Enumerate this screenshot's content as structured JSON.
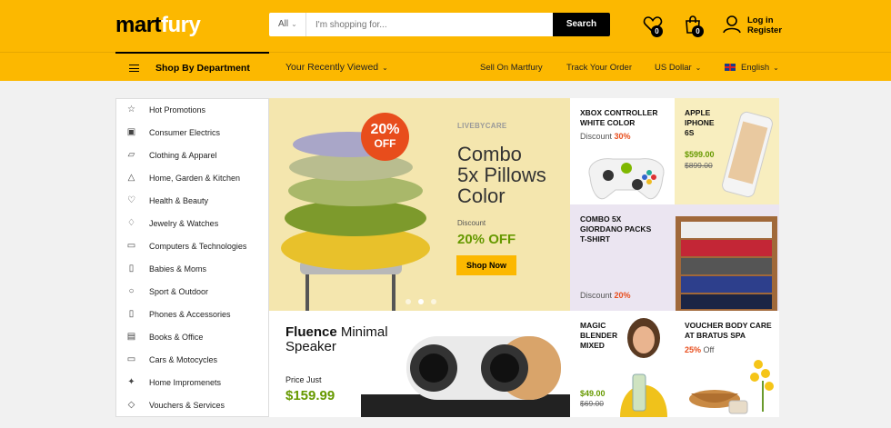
{
  "logo": {
    "part1": "mart",
    "part2": "fury"
  },
  "search": {
    "category": "All",
    "placeholder": "I'm shopping for...",
    "button": "Search"
  },
  "header": {
    "wishlist_count": "0",
    "cart_count": "0",
    "login": "Log in",
    "register": "Register"
  },
  "nav": {
    "shop_by_department": "Shop By Department",
    "recently_viewed": "Your Recently Viewed",
    "sell": "Sell On Martfury",
    "track": "Track Your Order",
    "currency": "US Dollar",
    "language": "English"
  },
  "sidebar": {
    "items": [
      {
        "label": "Hot Promotions",
        "icon": "star-icon"
      },
      {
        "label": "Consumer Electrics",
        "icon": "laundry-icon"
      },
      {
        "label": "Clothing & Apparel",
        "icon": "shirt-icon"
      },
      {
        "label": "Home, Garden & Kitchen",
        "icon": "lamp-icon"
      },
      {
        "label": "Health & Beauty",
        "icon": "heart-pulse-icon"
      },
      {
        "label": "Jewelry & Watches",
        "icon": "diamond-icon"
      },
      {
        "label": "Computers & Technologies",
        "icon": "desktop-icon"
      },
      {
        "label": "Babies & Moms",
        "icon": "baby-bottle-icon"
      },
      {
        "label": "Sport & Outdoor",
        "icon": "ball-icon"
      },
      {
        "label": "Phones & Accessories",
        "icon": "phone-icon"
      },
      {
        "label": "Books & Office",
        "icon": "book-icon"
      },
      {
        "label": "Cars & Motocycles",
        "icon": "car-icon"
      },
      {
        "label": "Home Impromenets",
        "icon": "wrench-icon"
      },
      {
        "label": "Vouchers & Services",
        "icon": "tag-icon"
      }
    ]
  },
  "hero": {
    "brand": "LIVEBYCARE",
    "title_line1": "Combo",
    "title_line2": "5x Pillows",
    "title_line3": "Color",
    "discount_label": "Discount",
    "discount_value": "20% OFF",
    "button": "Shop Now",
    "badge_pct": "20%",
    "badge_off": "OFF"
  },
  "speaker": {
    "title_bold": "Fluence",
    "title_rest": " Minimal",
    "title_line2": "Speaker",
    "price_label": "Price Just",
    "price": "$159.99"
  },
  "tiles": {
    "xbox": {
      "line1": "XBOX CONTROLLER",
      "line2": "WHITE COLOR",
      "discount_label": "Discount",
      "discount": "30%"
    },
    "iphone": {
      "line1": "APPLE",
      "line2": "IPHONE",
      "line3": "6S",
      "price": "$599.00",
      "old_price": "$899.00"
    },
    "tshirt": {
      "line1": "COMBO 5X",
      "line2": "GIORDANO PACKS",
      "line3": "T-SHIRT",
      "discount_label": "Discount",
      "discount": "20%"
    },
    "blender": {
      "line1": "MAGIC",
      "line2": "BLENDER",
      "line3": "MIXED",
      "price": "$49.00",
      "old_price": "$69.00"
    },
    "voucher": {
      "line1": "VOUCHER BODY CARE",
      "line2": "AT BRATUS SPA",
      "pct": "25%",
      "off": " Off"
    }
  }
}
